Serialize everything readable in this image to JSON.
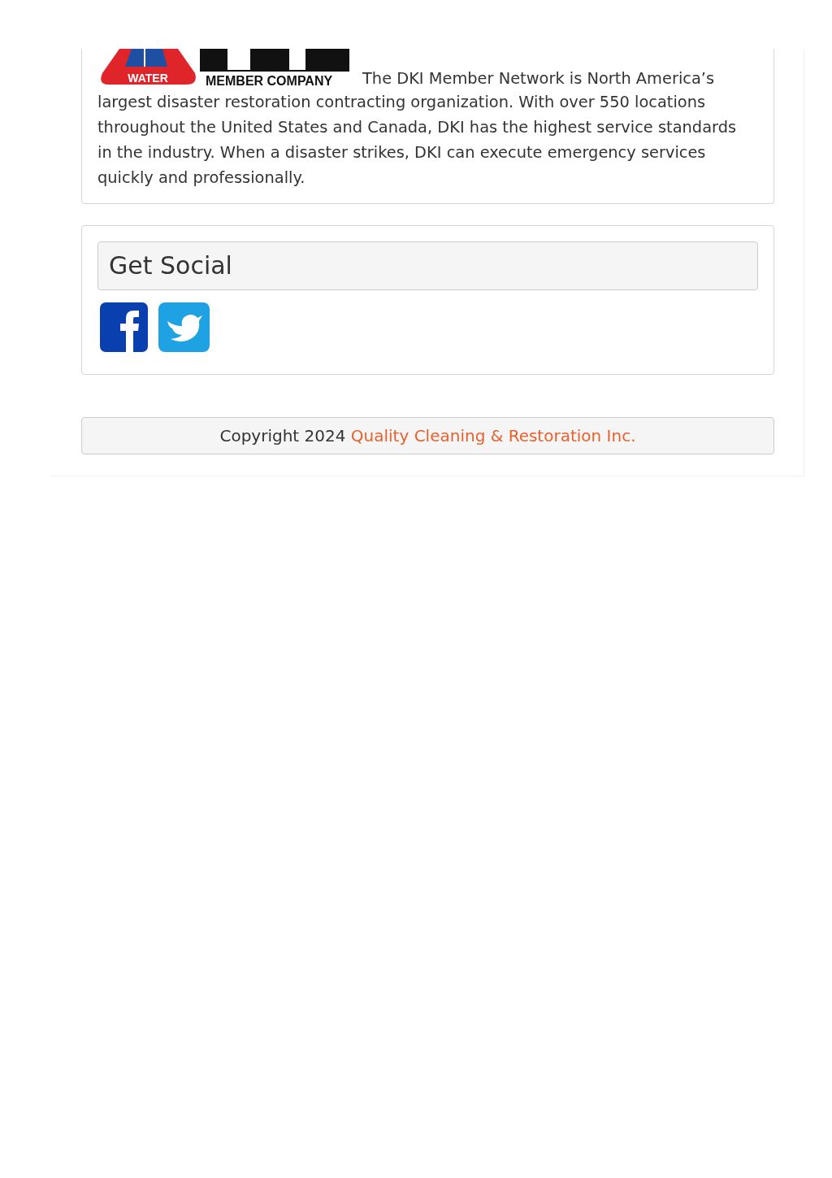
{
  "about": {
    "logo": {
      "badge_text": "WATER",
      "caption": "MEMBER COMPANY"
    },
    "text_lead": "The DKI Member Network is North America’s",
    "text": "largest disaster restoration contracting organization. With over 550 locations throughout the United States and Canada, DKI has the highest service standards in the industry. When a disaster strikes, DKI can execute emergency services quickly and professionally."
  },
  "social": {
    "title": "Get Social",
    "links": [
      {
        "kind": "facebook"
      },
      {
        "kind": "twitter"
      }
    ]
  },
  "footer": {
    "text": "Copyright 2024",
    "link": "Quality Cleaning & Restoration Inc."
  }
}
